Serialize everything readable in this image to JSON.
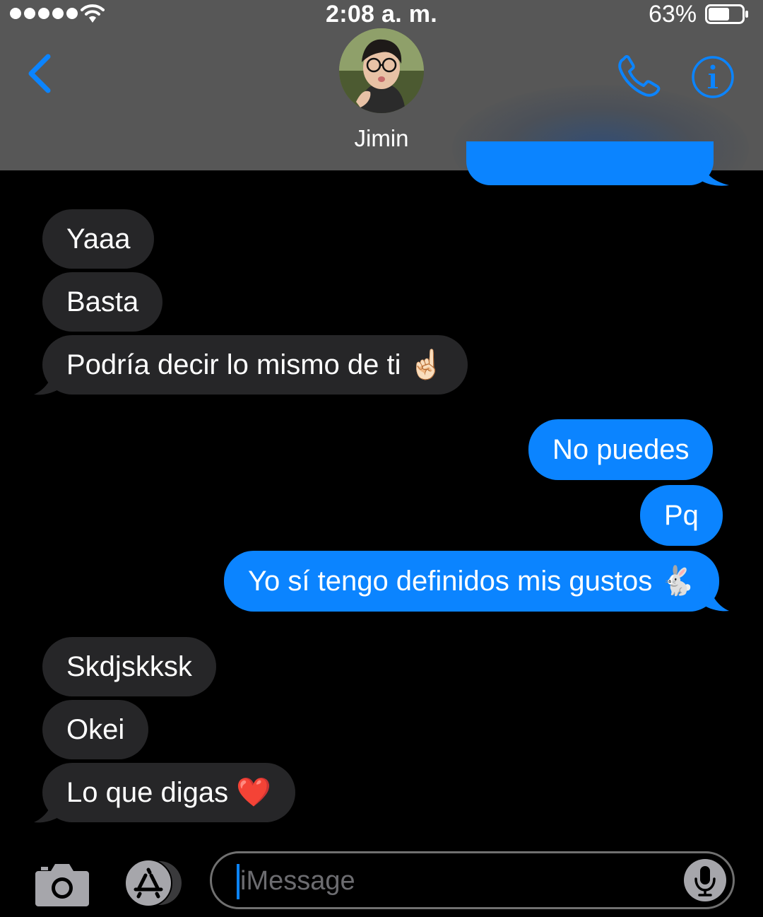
{
  "status_bar": {
    "time": "2:08 a. m.",
    "battery_percent": "63%",
    "battery_level": 0.63,
    "signal_bars": 5
  },
  "header": {
    "contact_name": "Jimin",
    "icons": [
      "chevron-left-icon",
      "phone-icon",
      "info-icon"
    ],
    "accent_color": "#0b84ff"
  },
  "messages": [
    {
      "direction": "incoming",
      "text": "Yaaa"
    },
    {
      "direction": "incoming",
      "text": "Basta"
    },
    {
      "direction": "incoming",
      "text": "Podría decir lo mismo de ti ☝🏻"
    },
    {
      "direction": "outgoing",
      "text": "No puedes"
    },
    {
      "direction": "outgoing",
      "text": "Pq"
    },
    {
      "direction": "outgoing",
      "text": "Yo sí tengo definidos mis gustos 🐇"
    },
    {
      "direction": "incoming",
      "text": "Skdjskksk"
    },
    {
      "direction": "incoming",
      "text": "Okei"
    },
    {
      "direction": "incoming",
      "text": "Lo que digas ❤️"
    }
  ],
  "compose": {
    "placeholder": "iMessage",
    "icons": [
      "camera-icon",
      "app-store-icon",
      "microphone-icon"
    ]
  },
  "colors": {
    "incoming_bubble": "#262628",
    "outgoing_bubble": "#0b84ff",
    "header_bg": "#575757",
    "background": "#000000"
  }
}
